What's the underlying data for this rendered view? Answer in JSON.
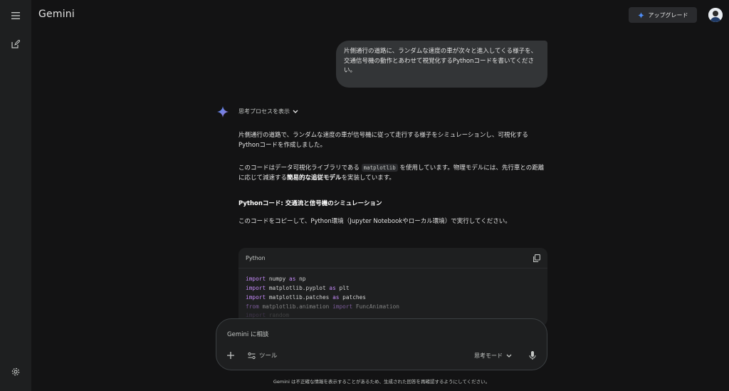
{
  "app": {
    "title": "Gemini"
  },
  "header": {
    "upgrade_label": "アップグレード"
  },
  "conversation": {
    "user_prompt": "片側通行の道路に、ランダムな速度の車が次々と進入してくる様子を、交通信号機の動作とあわせて視覚化するPythonコードを書いてください。",
    "thinking_label": "思考プロセスを表示",
    "response": {
      "p1": "片側通行の道路で、ランダムな速度の車が信号機に従って走行する様子をシミュレーションし、可視化するPythonコードを作成しました。",
      "p2_before": "このコードはデータ可視化ライブラリである",
      "p2_code": "matplotlib",
      "p2_mid": "を使用しています。物理モデルには、先行車との距離に応じて減速する",
      "p2_bold": "簡易的な追従モデル",
      "p2_after": "を実装しています。",
      "heading": "Pythonコード: 交通流と信号機のシミュレーション",
      "p3": "このコードをコピーして、Python環境（Jupyter Notebookやローカル環境）で実行してください。"
    },
    "code_block": {
      "language": "Python",
      "lines": [
        {
          "kw": "import",
          "rest": " numpy ",
          "kw2": "as",
          "rest2": " np"
        },
        {
          "kw": "import",
          "rest": " matplotlib.pyplot ",
          "kw2": "as",
          "rest2": " plt"
        },
        {
          "kw": "import",
          "rest": " matplotlib.patches ",
          "kw2": "as",
          "rest2": " patches"
        },
        {
          "kw": "from",
          "rest": " matplotlib.animation ",
          "kw2": "import",
          "rest2": " FuncAnimation"
        },
        {
          "kw": "import",
          "rest": " random",
          "kw2": "",
          "rest2": ""
        }
      ]
    }
  },
  "composer": {
    "placeholder": "Gemini に相談",
    "tools_label": "ツール",
    "mode_label": "思考モード"
  },
  "footer": {
    "disclaimer": "Gemini は不正確な情報を表示することがあるため、生成された回答を再確認するようにしてください。"
  },
  "colors": {
    "background": "#131314",
    "surface": "#1e1f20",
    "bubble": "#333537",
    "keyword": "#c58af9"
  }
}
